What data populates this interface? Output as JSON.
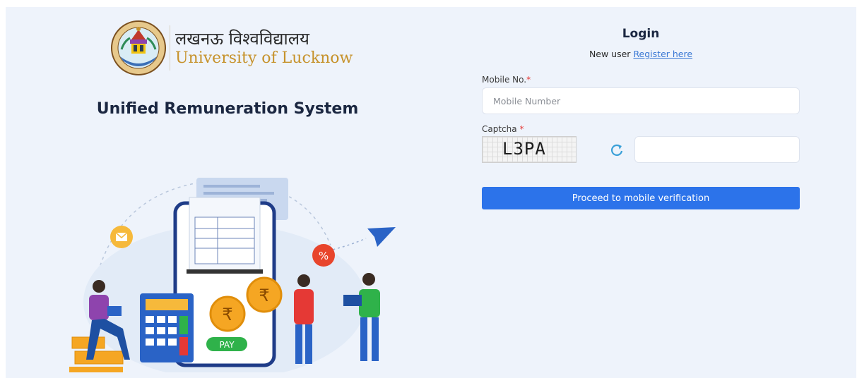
{
  "logo": {
    "hindi_name": "लखनऊ विश्वविद्यालय",
    "english_name": "University of Lucknow",
    "seal_icon": "university-seal-icon"
  },
  "system_title": "Unified Remuneration System",
  "illustration": {
    "pay_label": "PAY",
    "currency_symbol": "₹",
    "percent_symbol": "%"
  },
  "login": {
    "title": "Login",
    "new_user_text": "New user",
    "register_link": "Register here",
    "mobile_label": "Mobile No.",
    "mobile_placeholder": "Mobile Number",
    "mobile_value": "",
    "captcha_label": "Captcha",
    "captcha_text": "L3PA",
    "captcha_input_value": "",
    "required_mark": "*",
    "refresh_icon": "refresh-icon",
    "proceed_button": "Proceed to mobile verification"
  },
  "colors": {
    "background": "#eef3fb",
    "primary": "#2c73ea",
    "title_text": "#1b2741",
    "link": "#3a78d4",
    "required": "#e53935",
    "logo_gold": "#c6922b"
  }
}
